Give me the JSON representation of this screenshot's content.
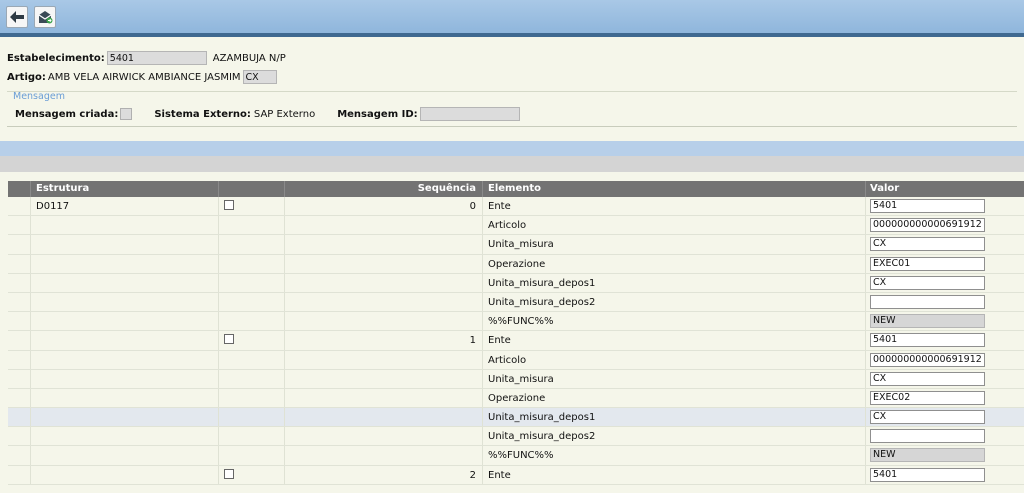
{
  "header": {
    "estabelecimento_label": "Estabelecimento:",
    "estabelecimento_value": "5401",
    "estabelecimento_name": "AZAMBUJA N/P",
    "artigo_label": "Artigo:",
    "artigo_desc": "AMB VELA AIRWICK AMBIANCE JASMIM",
    "artigo_unit": "CX"
  },
  "mensagem": {
    "legend": "Mensagem",
    "criada_label": "Mensagem criada:",
    "sistema_label": "Sistema Externo:",
    "sistema_value": "SAP Externo",
    "id_label": "Mensagem ID:",
    "id_value": ""
  },
  "grid": {
    "columns": {
      "estrutura": "Estrutura",
      "sequencia": "Sequência",
      "elemento": "Elemento",
      "valor": "Valor"
    },
    "rows": [
      {
        "estrutura": "D0117",
        "check": true,
        "seq": "0",
        "elemento": "Ente",
        "valor": "5401",
        "ro": false
      },
      {
        "estrutura": "",
        "check": false,
        "seq": "",
        "elemento": "Articolo",
        "valor": "000000000000691912",
        "ro": false
      },
      {
        "estrutura": "",
        "check": false,
        "seq": "",
        "elemento": "Unita_misura",
        "valor": "CX",
        "ro": false
      },
      {
        "estrutura": "",
        "check": false,
        "seq": "",
        "elemento": "Operazione",
        "valor": "EXEC01",
        "ro": false
      },
      {
        "estrutura": "",
        "check": false,
        "seq": "",
        "elemento": "Unita_misura_depos1",
        "valor": "CX",
        "ro": false
      },
      {
        "estrutura": "",
        "check": false,
        "seq": "",
        "elemento": "Unita_misura_depos2",
        "valor": "",
        "ro": false
      },
      {
        "estrutura": "",
        "check": false,
        "seq": "",
        "elemento": "%%FUNC%%",
        "valor": "NEW",
        "ro": true
      },
      {
        "estrutura": "",
        "check": true,
        "seq": "1",
        "elemento": "Ente",
        "valor": "5401",
        "ro": false
      },
      {
        "estrutura": "",
        "check": false,
        "seq": "",
        "elemento": "Articolo",
        "valor": "000000000000691912",
        "ro": false
      },
      {
        "estrutura": "",
        "check": false,
        "seq": "",
        "elemento": "Unita_misura",
        "valor": "CX",
        "ro": false
      },
      {
        "estrutura": "",
        "check": false,
        "seq": "",
        "elemento": "Operazione",
        "valor": "EXEC02",
        "ro": false
      },
      {
        "estrutura": "",
        "check": false,
        "seq": "",
        "elemento": "Unita_misura_depos1",
        "valor": "CX",
        "ro": false,
        "highlight": true
      },
      {
        "estrutura": "",
        "check": false,
        "seq": "",
        "elemento": "Unita_misura_depos2",
        "valor": "",
        "ro": false
      },
      {
        "estrutura": "",
        "check": false,
        "seq": "",
        "elemento": "%%FUNC%%",
        "valor": "NEW",
        "ro": true
      },
      {
        "estrutura": "",
        "check": true,
        "seq": "2",
        "elemento": "Ente",
        "valor": "5401",
        "ro": false
      }
    ]
  },
  "icons": {
    "back": "back-arrow-icon",
    "send": "send-message-icon"
  }
}
